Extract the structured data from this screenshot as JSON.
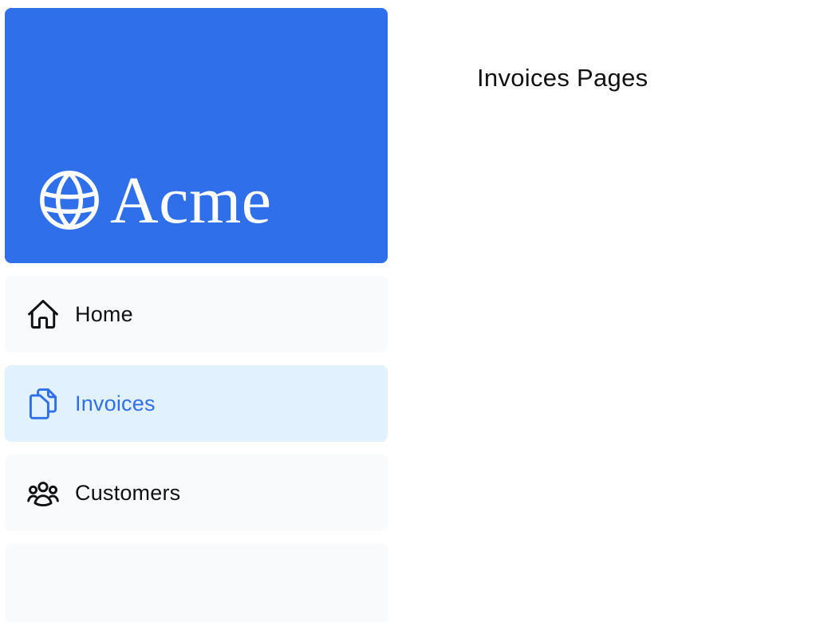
{
  "brand": {
    "name": "Acme",
    "logo_icon": "globe-icon",
    "color": "#2f6fea"
  },
  "sidebar": {
    "items": [
      {
        "label": "Home",
        "icon": "home-icon",
        "active": false
      },
      {
        "label": "Invoices",
        "icon": "document-duplicate-icon",
        "active": true
      },
      {
        "label": "Customers",
        "icon": "user-group-icon",
        "active": false
      }
    ],
    "active_color": "#2f6fea",
    "active_background": "#e2f1fe",
    "item_background": "#f8fafc"
  },
  "main": {
    "title": "Invoices Pages"
  }
}
